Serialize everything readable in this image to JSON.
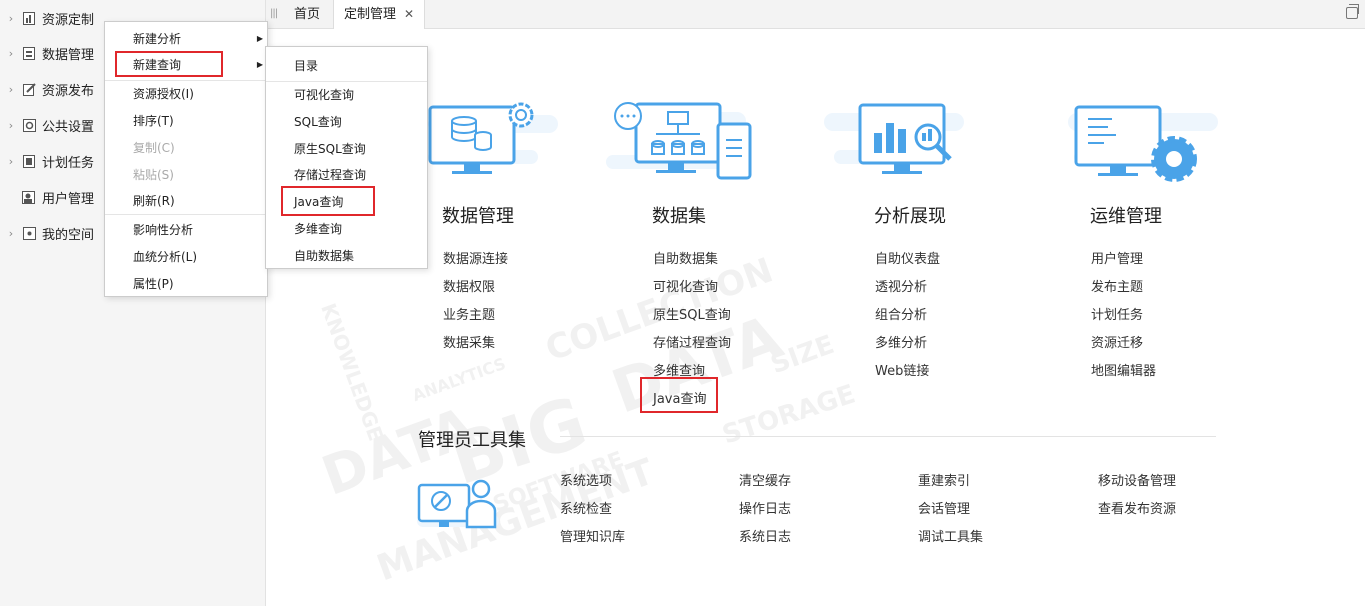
{
  "sidebar": {
    "items": [
      {
        "label": "资源定制",
        "icon": "report-icon"
      },
      {
        "label": "数据管理",
        "icon": "database-icon"
      },
      {
        "label": "资源发布",
        "icon": "edit-icon"
      },
      {
        "label": "公共设置",
        "icon": "gear-icon"
      },
      {
        "label": "计划任务",
        "icon": "task-icon"
      },
      {
        "label": "用户管理",
        "icon": "user-icon"
      },
      {
        "label": "我的空间",
        "icon": "space-icon"
      }
    ]
  },
  "tabs": {
    "handle": "|||",
    "items": [
      {
        "label": "首页"
      },
      {
        "label": "定制管理",
        "close": "✕"
      }
    ]
  },
  "context_menu": {
    "items": [
      {
        "label": "新建分析"
      },
      {
        "label": "新建查询"
      },
      {
        "label": "资源授权(I)"
      },
      {
        "label": "排序(T)"
      },
      {
        "label": "复制(C)"
      },
      {
        "label": "粘贴(S)"
      },
      {
        "label": "刷新(R)"
      },
      {
        "label": "影响性分析"
      },
      {
        "label": "血统分析(L)"
      },
      {
        "label": "属性(P)"
      }
    ],
    "arrow": "▶"
  },
  "submenu": {
    "items": [
      {
        "label": "目录"
      },
      {
        "label": "可视化查询"
      },
      {
        "label": "SQL查询"
      },
      {
        "label": "原生SQL查询"
      },
      {
        "label": "存储过程查询"
      },
      {
        "label": "Java查询"
      },
      {
        "label": "多维查询"
      },
      {
        "label": "自助数据集"
      }
    ]
  },
  "cards": [
    {
      "title": "数据管理",
      "links": [
        "数据源连接",
        "数据权限",
        "业务主题",
        "数据采集"
      ]
    },
    {
      "title": "数据集",
      "links": [
        "自助数据集",
        "可视化查询",
        "原生SQL查询",
        "存储过程查询",
        "多维查询",
        "Java查询"
      ]
    },
    {
      "title": "分析展现",
      "links": [
        "自助仪表盘",
        "透视分析",
        "组合分析",
        "多维分析",
        "Web链接"
      ]
    },
    {
      "title": "运维管理",
      "links": [
        "用户管理",
        "发布主题",
        "计划任务",
        "资源迁移",
        "地图编辑器"
      ]
    }
  ],
  "admin_tools": {
    "title": "管理员工具集",
    "columns": [
      [
        "系统选项",
        "系统检查",
        "管理知识库"
      ],
      [
        "清空缓存",
        "操作日志",
        "系统日志"
      ],
      [
        "重建索引",
        "会话管理",
        "调试工具集"
      ],
      [
        "移动设备管理",
        "查看发布资源"
      ]
    ]
  },
  "colors": {
    "accent_blue": "#4aa3e8",
    "highlight_red": "#e0272b"
  }
}
